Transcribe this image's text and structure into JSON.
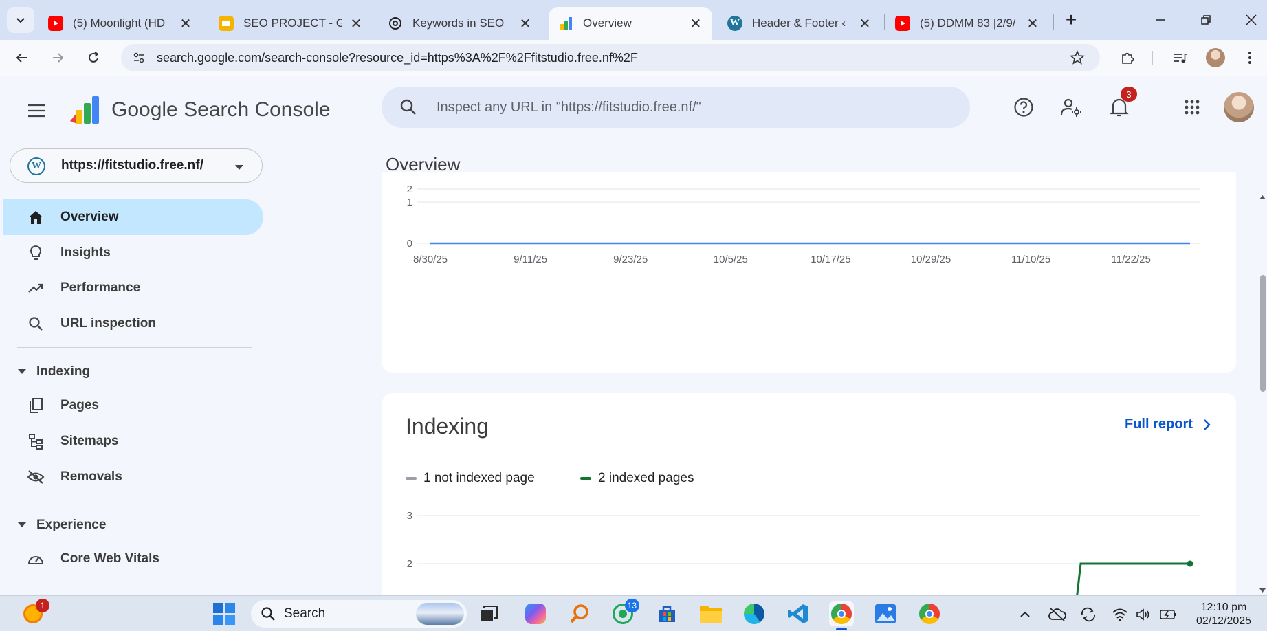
{
  "browser": {
    "tabs": [
      {
        "title": "(5) Moonlight (HD",
        "favicon": "youtube-icon",
        "color": "#ff0000"
      },
      {
        "title": "SEO PROJECT - Go",
        "favicon": "slides-icon",
        "color": "#f4b400"
      },
      {
        "title": "Keywords in SEO",
        "favicon": "openai-icon",
        "color": "#222222"
      },
      {
        "title": "Overview",
        "favicon": "search-console-icon",
        "color": "#4285f4"
      },
      {
        "title": "Header & Footer ‹",
        "favicon": "wordpress-icon",
        "color": "#21759b"
      },
      {
        "title": "(5) DDMM 83 |2/9/",
        "favicon": "youtube-icon",
        "color": "#ff0000"
      }
    ],
    "new_tab_label": "+",
    "url": "search.google.com/search-console?resource_id=https%3A%2F%2Ffitstudio.free.nf%2F"
  },
  "app": {
    "name": "Google Search Console",
    "search_placeholder": "Inspect any URL in \"https://fitstudio.free.nf/\"",
    "notifications_count": "3"
  },
  "sidebar": {
    "property": "https://fitstudio.free.nf/",
    "items": [
      {
        "label": "Overview",
        "icon": "home-icon"
      },
      {
        "label": "Insights",
        "icon": "lightbulb-icon"
      },
      {
        "label": "Performance",
        "icon": "trending-up-icon"
      },
      {
        "label": "URL inspection",
        "icon": "search-icon"
      }
    ],
    "indexing": {
      "label": "Indexing",
      "items": [
        {
          "label": "Pages",
          "icon": "pages-icon"
        },
        {
          "label": "Sitemaps",
          "icon": "sitemap-icon"
        },
        {
          "label": "Removals",
          "icon": "eye-off-icon"
        }
      ]
    },
    "experience": {
      "label": "Experience",
      "items": [
        {
          "label": "Core Web Vitals",
          "icon": "speed-icon"
        }
      ]
    }
  },
  "main": {
    "page_title": "Overview",
    "indexing_card": {
      "title": "Indexing",
      "full_report": "Full report",
      "legend": [
        {
          "label": "1 not indexed page",
          "color": "#9aa0a6"
        },
        {
          "label": "2 indexed pages",
          "color": "#137333"
        }
      ]
    }
  },
  "chart_data": [
    {
      "type": "line",
      "x": [
        "8/30/25",
        "9/11/25",
        "9/23/25",
        "10/5/25",
        "10/17/25",
        "10/29/25",
        "11/10/25",
        "11/22/25"
      ],
      "series": [
        {
          "values": [
            0,
            0,
            0,
            0,
            0,
            0,
            0,
            0
          ],
          "color": "#4285f4"
        }
      ],
      "yticks": [
        "0",
        "1",
        "2"
      ],
      "ylim": [
        0,
        2
      ],
      "grid": true
    },
    {
      "type": "line",
      "yticks": [
        "2",
        "3"
      ],
      "series": [
        {
          "name": "2 indexed pages",
          "color": "#137333",
          "end_value": 2
        }
      ]
    }
  ],
  "taskbar": {
    "search_label": "Search",
    "whatsapp_badge": "13",
    "notification_badge": "1",
    "time": "12:10 pm",
    "date": "02/12/2025"
  }
}
